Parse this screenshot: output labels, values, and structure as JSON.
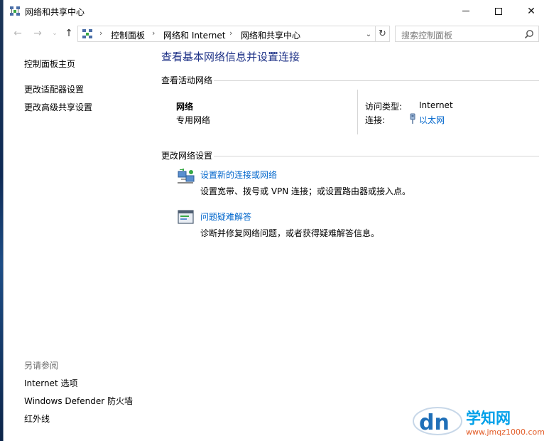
{
  "window": {
    "title": "网络和共享中心",
    "controls": {
      "minimize": "—",
      "maximize": "□",
      "close": "✕"
    }
  },
  "nav": {
    "back": "←",
    "forward": "→",
    "recent": "⌄",
    "up": "↑"
  },
  "address": {
    "breadcrumbs": [
      "控制面板",
      "网络和 Internet",
      "网络和共享中心"
    ],
    "separator": "›",
    "dropdown": "⌄",
    "refresh": "↻"
  },
  "search": {
    "placeholder": "搜索控制面板"
  },
  "left_pane": {
    "links": [
      "控制面板主页",
      "更改适配器设置",
      "更改高级共享设置"
    ],
    "see_also_header": "另请参阅",
    "see_also": [
      "Internet 选项",
      "Windows Defender 防火墙",
      "红外线"
    ]
  },
  "main": {
    "title": "查看基本网络信息并设置连接",
    "active_networks_header": "查看活动网络",
    "network": {
      "name": "网络",
      "type": "专用网络",
      "access_type_label": "访问类型:",
      "access_type_value": "Internet",
      "connections_label": "连接:",
      "connection_link": "以太网"
    },
    "change_settings_header": "更改网络设置",
    "tasks": [
      {
        "title": "设置新的连接或网络",
        "desc": "设置宽带、拨号或 VPN 连接；或设置路由器或接入点。"
      },
      {
        "title": "问题疑难解答",
        "desc": "诊断并修复网络问题，或者获得疑难解答信息。"
      }
    ]
  },
  "watermark": {
    "text": "学知网",
    "url": "www.jmqz1000.com"
  }
}
